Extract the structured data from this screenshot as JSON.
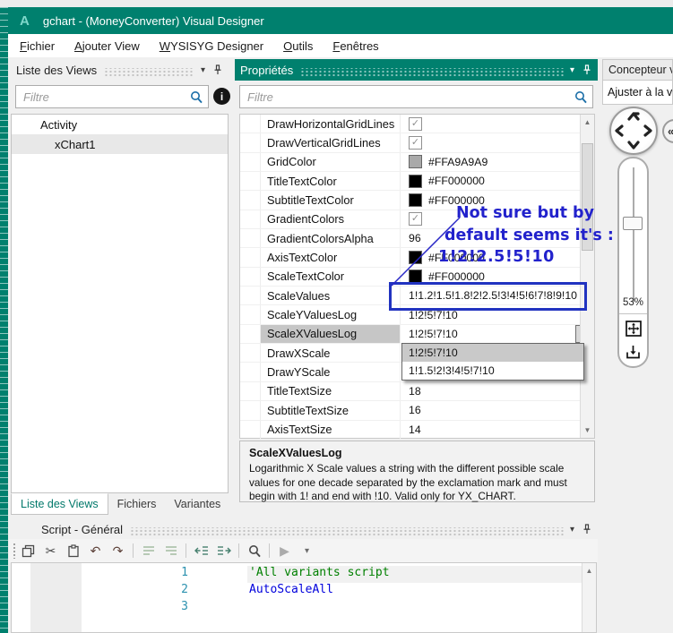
{
  "window": {
    "title": "gchart - (MoneyConverter) Visual Designer",
    "logo_letter": "A"
  },
  "menu": [
    "Fichier",
    "Ajouter View",
    "WYSISYG Designer",
    "Outils",
    "Fenêtres"
  ],
  "left_panel": {
    "title": "Liste des Views",
    "filter_placeholder": "Filtre",
    "tree": [
      {
        "label": "Activity",
        "level": 1,
        "selected": false
      },
      {
        "label": "xChart1",
        "level": 2,
        "selected": true
      }
    ],
    "tabs": [
      {
        "label": "Liste des Views",
        "active": true
      },
      {
        "label": "Fichiers",
        "active": false
      },
      {
        "label": "Variantes",
        "active": false
      }
    ]
  },
  "properties_panel": {
    "title": "Propriétés",
    "filter_placeholder": "Filtre",
    "rows": [
      {
        "label": "DrawHorizontalGridLines",
        "type": "checkbox",
        "checked": true
      },
      {
        "label": "DrawVerticalGridLines",
        "type": "checkbox",
        "checked": true
      },
      {
        "label": "GridColor",
        "type": "color",
        "swatch": "#A9A9A9",
        "value": "#FFA9A9A9",
        "caret": true
      },
      {
        "label": "TitleTextColor",
        "type": "color",
        "swatch": "#000000",
        "value": "#FF000000",
        "caret": true
      },
      {
        "label": "SubtitleTextColor",
        "type": "color",
        "swatch": "#000000",
        "value": "#FF000000",
        "caret": true
      },
      {
        "label": "GradientColors",
        "type": "checkbox",
        "checked": true
      },
      {
        "label": "GradientColorsAlpha",
        "type": "text",
        "value": "96",
        "caret": false
      },
      {
        "label": "AxisTextColor",
        "type": "color",
        "swatch": "#000000",
        "value": "#FF000000",
        "caret": true
      },
      {
        "label": "ScaleTextColor",
        "type": "color",
        "swatch": "#000000",
        "value": "#FF000000",
        "caret": true
      },
      {
        "label": "ScaleValues",
        "type": "text",
        "value": "1!1.2!1.5!1.8!2!2.5!3!4!5!6!7!8!9!10",
        "caret": true
      },
      {
        "label": "ScaleYValuesLog",
        "type": "text",
        "value": "1!2!5!7!10",
        "caret": true
      },
      {
        "label": "ScaleXValuesLog",
        "type": "text",
        "value": "1!2!5!7!10",
        "caret": false,
        "selected": true,
        "open": true
      },
      {
        "label": "DrawXScale",
        "type": "text",
        "value": "",
        "caret": false
      },
      {
        "label": "DrawYScale",
        "type": "text",
        "value": "",
        "caret": false
      },
      {
        "label": "TitleTextSize",
        "type": "text",
        "value": "18",
        "caret": false
      },
      {
        "label": "SubtitleTextSize",
        "type": "text",
        "value": "16",
        "caret": false
      },
      {
        "label": "AxisTextSize",
        "type": "text",
        "value": "14",
        "caret": false
      }
    ],
    "dropdown_items": [
      {
        "label": "1!2!5!7!10",
        "selected": true
      },
      {
        "label": "1!1.5!2!3!4!5!7!10",
        "selected": false
      }
    ],
    "description": {
      "title": "ScaleXValuesLog",
      "text": "Logarithmic X Scale values a string with the different possible scale values for one decade separated by the exclamation mark and must begin with 1! and end with !10. Valid only for YX_CHART."
    }
  },
  "designer_panel": {
    "title": "Concepteur v",
    "fit_button": "Ajuster à la va",
    "zoom_percent": "53%"
  },
  "script_panel": {
    "title": "Script - Général",
    "toolbar_icons": [
      "copy",
      "cut",
      "paste",
      "undo",
      "redo",
      "indent-left",
      "indent-right",
      "shift-left",
      "shift-right",
      "search",
      "play",
      "overflow"
    ],
    "lines": [
      {
        "number": "1",
        "code": "'All variants script",
        "kind": "comment",
        "highlight": true
      },
      {
        "number": "2",
        "code": "AutoScaleAll",
        "kind": "keyword",
        "highlight": false
      },
      {
        "number": "3",
        "code": "",
        "kind": "plain",
        "highlight": false
      }
    ]
  },
  "annotation": {
    "lines": [
      "Not sure but by",
      "default seems it's :",
      "1!2!2.5!5!10"
    ],
    "color": "#2222CC"
  },
  "colors": {
    "titlebar_teal": "#00806E",
    "annotation_blue": "#2222CC",
    "highlight_box_border": "#2133C0",
    "comment_green": "#008000",
    "keyword_blue": "#0000DC",
    "line_number_teal": "#2B91AF",
    "grid_color_value": "#A9A9A9"
  }
}
